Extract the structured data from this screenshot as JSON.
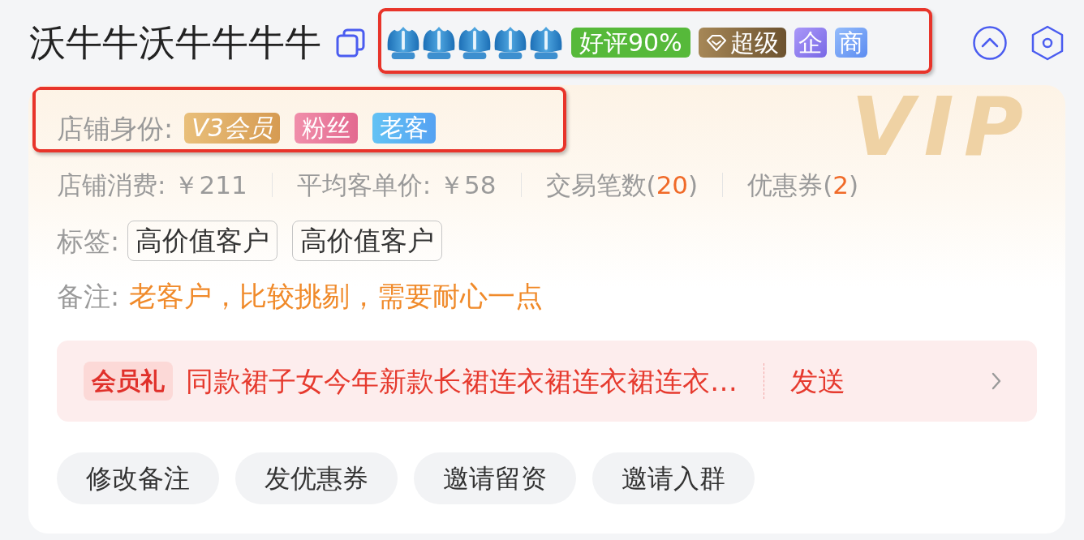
{
  "header": {
    "name": "沃牛牛沃牛牛牛牛",
    "badge_group": {
      "highlighted": true,
      "crowns": {
        "stars": 5
      },
      "badges": [
        {
          "kind": "rating",
          "text": "好评90%"
        },
        {
          "kind": "super",
          "text": "超级"
        },
        {
          "kind": "enterprise",
          "text": "企"
        },
        {
          "kind": "merchant",
          "text": "商"
        }
      ]
    }
  },
  "card": {
    "watermark": "VIP",
    "identity": {
      "highlighted": true,
      "label": "店铺身份:",
      "badges": [
        {
          "kind": "vip",
          "text": "V3会员"
        },
        {
          "kind": "fan",
          "text": "粉丝"
        },
        {
          "kind": "regular",
          "text": "老客"
        }
      ]
    },
    "stats": [
      {
        "kind": "amount",
        "label": "店铺消费:",
        "value": "￥211"
      },
      {
        "kind": "amount",
        "label": "平均客单价:",
        "value": "￥58"
      },
      {
        "kind": "count",
        "label": "交易笔数(",
        "value": "20",
        "suffix": ")"
      },
      {
        "kind": "count",
        "label": "优惠券(",
        "value": "2",
        "suffix": ")"
      }
    ],
    "tags": {
      "label": "标签:",
      "items": [
        "高价值客户",
        "高价值客户"
      ]
    },
    "remark": {
      "label": "备注:",
      "text": "老客户，比较挑剔，需要耐心一点"
    },
    "gift": {
      "tag": "会员礼",
      "product": "同款裙子女今年新款长裙连衣裙连衣裙连衣…",
      "action": "发送"
    },
    "actions": [
      "修改备注",
      "发优惠券",
      "邀请留资",
      "邀请入群"
    ]
  }
}
